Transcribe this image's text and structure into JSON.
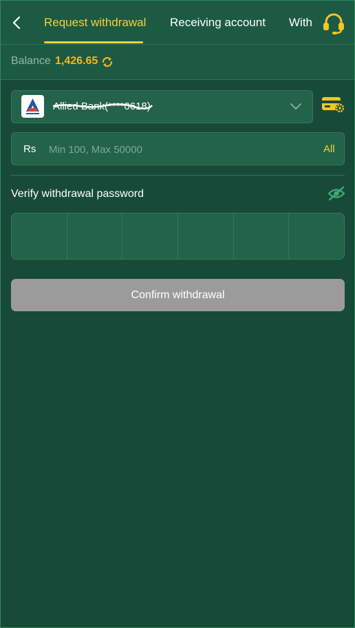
{
  "header": {
    "tabs": [
      {
        "label": "Request withdrawal",
        "active": true
      },
      {
        "label": "Receiving account",
        "active": false
      },
      {
        "label": "With",
        "active": false
      }
    ],
    "icons": {
      "back": "chevron-left-icon",
      "support": "headset-icon"
    }
  },
  "balance": {
    "label": "Balance",
    "value": "1,426.65",
    "icon": "refresh-icon"
  },
  "bank": {
    "name": "Allied Bank(****0618)",
    "logo": "allied-bank-logo",
    "icon": "chevron-down-icon",
    "settings_icon": "card-settings-icon"
  },
  "amount": {
    "currency": "Rs",
    "placeholder": "Min 100, Max 50000",
    "all_label": "All"
  },
  "password": {
    "label": "Verify withdrawal password",
    "icon": "eye-off-icon",
    "digits": 6
  },
  "confirm_label": "Confirm withdrawal",
  "colors": {
    "background": "#184a3a",
    "surface": "#22634a",
    "accent": "#f3d23c",
    "balance": "#f5b81c",
    "button_disabled": "#9b9b9b"
  }
}
